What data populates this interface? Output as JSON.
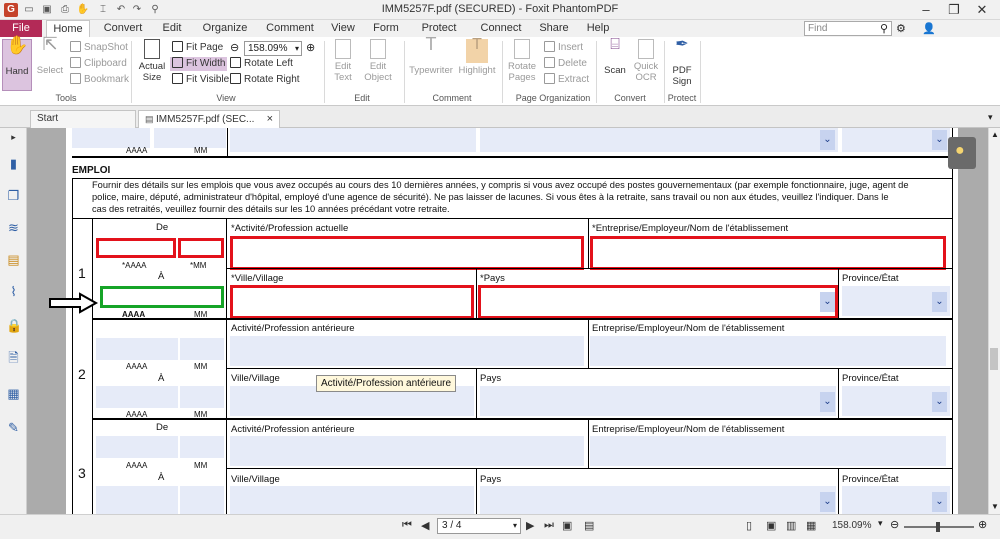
{
  "window": {
    "title": "IMM5257F.pdf (SECURED) - Foxit PhantomPDF",
    "app_logo": "G"
  },
  "menu": {
    "file": "File",
    "tabs": [
      "Home",
      "Convert",
      "Edit",
      "Organize",
      "Comment",
      "View",
      "Form",
      "Protect",
      "Connect",
      "Share",
      "Help"
    ],
    "search_placeholder": "Find"
  },
  "ribbon": {
    "hand": "Hand",
    "select": "Select",
    "snapshot": "SnapShot",
    "clipboard": "Clipboard",
    "bookmark": "Bookmark",
    "tools_label": "Tools",
    "actual_size": [
      "Actual",
      "Size"
    ],
    "fit_page": "Fit Page",
    "fit_width": "Fit Width",
    "fit_visible": "Fit Visible",
    "zoom": "158.09%",
    "rotate_left": "Rotate Left",
    "rotate_right": "Rotate Right",
    "view_label": "View",
    "edit_text": [
      "Edit",
      "Text"
    ],
    "edit_object": [
      "Edit",
      "Object"
    ],
    "edit_label": "Edit",
    "typewriter": "Typewriter",
    "highlight": "Highlight",
    "comment_label": "Comment",
    "rotate_pages": [
      "Rotate",
      "Pages"
    ],
    "insert": "Insert",
    "delete": "Delete",
    "extract": "Extract",
    "page_org_label": "Page Organization",
    "scan": "Scan",
    "quick_ocr": [
      "Quick",
      "OCR"
    ],
    "convert_label": "Convert",
    "pdf_sign": [
      "PDF",
      "Sign"
    ],
    "protect_label": "Protect"
  },
  "doc_tabs": {
    "start": "Start",
    "file": "IMM5257F.pdf (SEC...",
    "close": "×"
  },
  "form": {
    "section_title": "EMPLOI",
    "intro": [
      "Fournir des détails sur les emplois que vous avez occupés au cours des 10  dernières années, y compris si vous avez occupé des postes gouvernementaux (par exemple fonctionnaire, juge, agent de",
      "police, maire, député, administrateur d'hôpital, employé d'une agence de sécurité). Ne pas laisser de lacunes. Si vous êtes à la retraite, sans travail ou non aux études, veuillez l'indiquer. Dans le",
      "cas des retraités, veuillez fournir des détails sur les 10 années précédant votre retraite."
    ],
    "top": {
      "aaaa": "AAAA",
      "mm": "MM"
    },
    "row1": {
      "num": "1",
      "de": "De",
      "aaaa": "*AAAA",
      "mm": "*MM",
      "a": "À",
      "aaaa2": "AAAA",
      "mm2": "MM",
      "activite": "*Activité/Profession actuelle",
      "entreprise": "*Entreprise/Employeur/Nom de l'établissement",
      "ville": "*Ville/Village",
      "pays": "*Pays",
      "province": "Province/État"
    },
    "row2": {
      "num": "2",
      "aaaa": "AAAA",
      "mm": "MM",
      "a": "À",
      "aaaa2": "AAAA",
      "mm2": "MM",
      "activite": "Activité/Profession antérieure",
      "entreprise": "Entreprise/Employeur/Nom de l'établissement",
      "ville": "Ville/Village",
      "pays": "Pays",
      "province": "Province/État"
    },
    "row3": {
      "num": "3",
      "de": "De",
      "aaaa": "AAAA",
      "mm": "MM",
      "a": "À",
      "activite": "Activité/Profession antérieure",
      "entreprise": "Entreprise/Employeur/Nom de l'établissement",
      "ville": "Ville/Village",
      "pays": "Pays",
      "province": "Province/État"
    },
    "tooltip": "Activité/Profession antérieure"
  },
  "status": {
    "page": "3 / 4",
    "zoom": "158.09%"
  }
}
